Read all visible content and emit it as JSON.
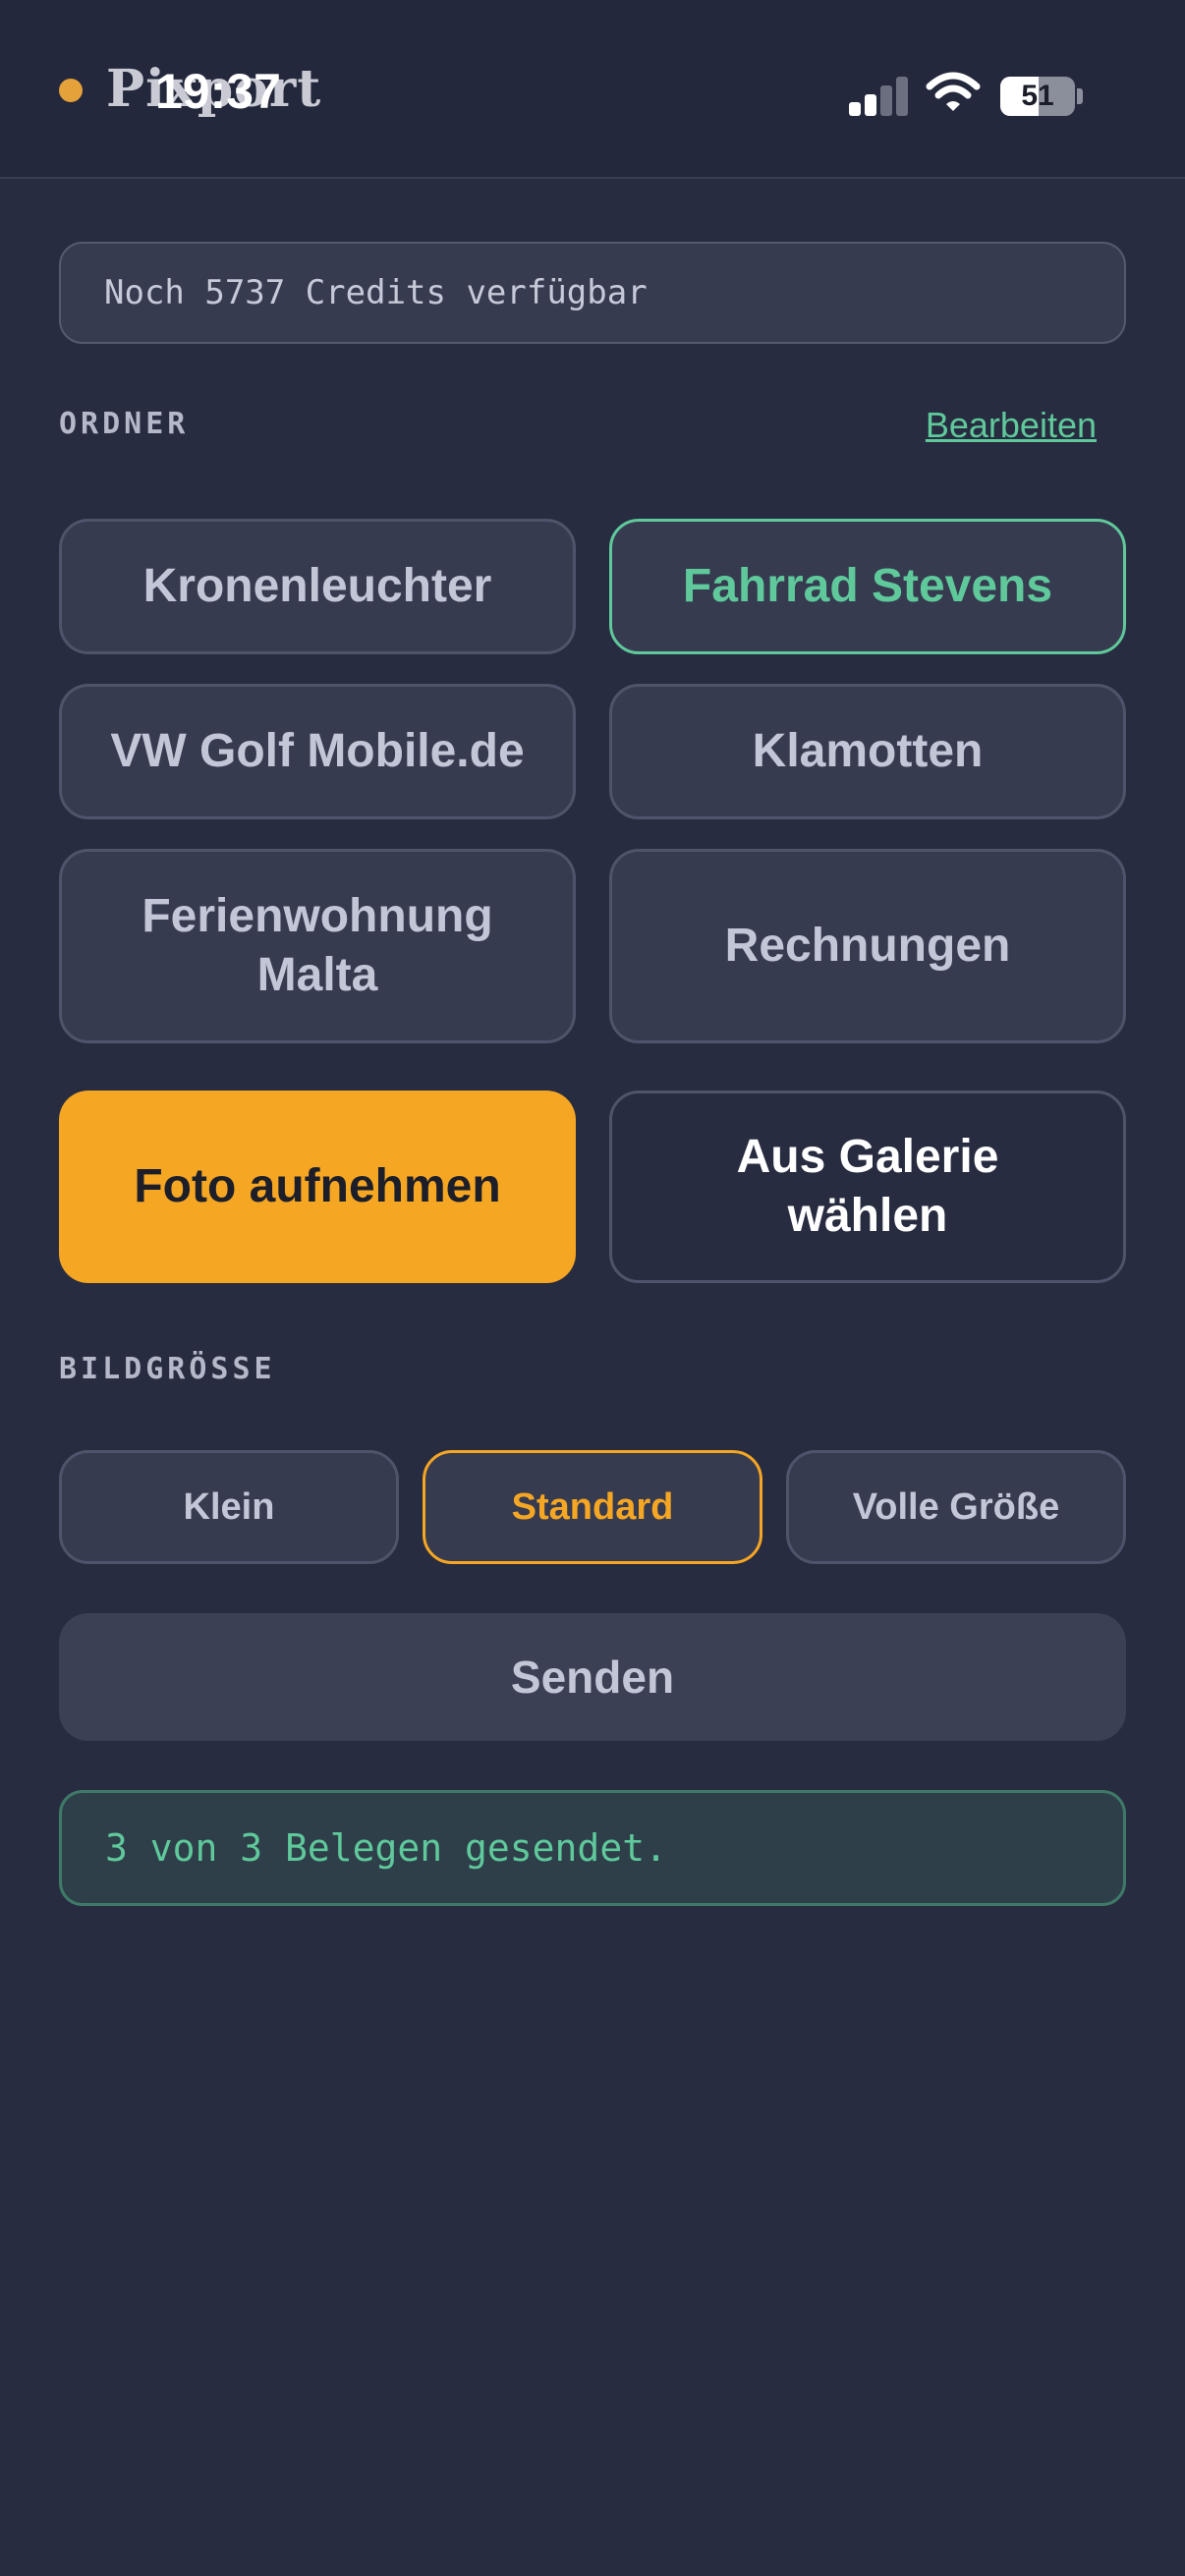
{
  "status_bar": {
    "time": "19:37",
    "battery_level": "51",
    "battery_fraction": 0.51
  },
  "app": {
    "title": "Pixport"
  },
  "credits": {
    "text": "Noch 5737 Credits verfügbar"
  },
  "folders": {
    "label": "ORDNER",
    "edit_label": "Bearbeiten",
    "items": [
      {
        "label": "Kronenleuchter",
        "selected": false
      },
      {
        "label": "Fahrrad Stevens",
        "selected": true
      },
      {
        "label": "VW Golf Mobile.de",
        "selected": false
      },
      {
        "label": "Klamotten",
        "selected": false
      },
      {
        "label": "Ferienwohnung Malta",
        "selected": false
      },
      {
        "label": "Rechnungen",
        "selected": false
      }
    ]
  },
  "actions": {
    "camera_label": "Foto aufnehmen",
    "gallery_label": "Aus Galerie wählen"
  },
  "image_size": {
    "label": "BILDGRÖSSE",
    "options": [
      {
        "label": "Klein",
        "selected": false
      },
      {
        "label": "Standard",
        "selected": true
      },
      {
        "label": "Volle Größe",
        "selected": false
      }
    ]
  },
  "send": {
    "label": "Senden"
  },
  "result": {
    "text": "3 von 3 Belegen gesendet."
  },
  "colors": {
    "background": "#282c40",
    "accent_green": "#5fc99b",
    "accent_orange": "#f5a623"
  }
}
